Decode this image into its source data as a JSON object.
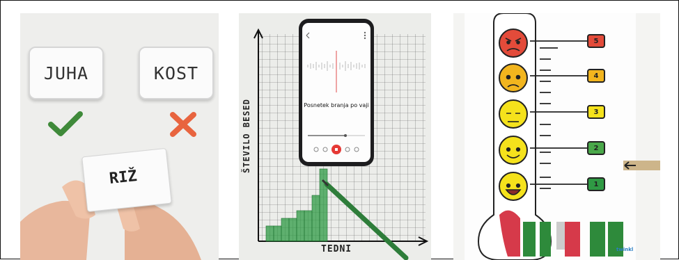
{
  "panel1": {
    "card_left": "JUHA",
    "card_right": "KOST",
    "hand_card": "RIŽ"
  },
  "panel2": {
    "y_axis_label": "ŠTEVILO BESED",
    "x_axis_label": "TEDNI",
    "phone_title": "Posnetek branja po vaji"
  },
  "panel3": {
    "levels": [
      "5",
      "4",
      "3",
      "2",
      "1"
    ],
    "word_art": "Juhu",
    "brand": "twinkl"
  },
  "colors": {
    "check": "#3f8a3a",
    "cross": "#e8643f",
    "bars": "#2f9a44",
    "level5": "#e34b3a",
    "level4": "#f2b51e",
    "level3": "#f5e21c",
    "level2": "#4aa84a",
    "level1": "#2f9a44"
  }
}
